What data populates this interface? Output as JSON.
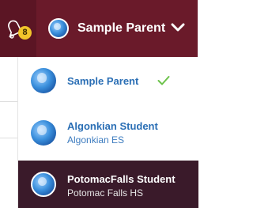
{
  "topbar": {
    "notification_count": "8",
    "user_name": "Sample Parent"
  },
  "menu": {
    "items": [
      {
        "name": "Sample Parent",
        "school": "",
        "checked": true
      },
      {
        "name": "Algonkian Student",
        "school": "Algonkian ES"
      },
      {
        "name": "PotomacFalls Student",
        "school": "Potomac Falls HS"
      }
    ]
  },
  "colors": {
    "topbar": "#6a1a2a",
    "selected_item_bg": "#3a1a2a",
    "link_blue": "#2b6fb5",
    "check_green": "#6cc24a",
    "badge_yellow": "#f2c42b"
  }
}
